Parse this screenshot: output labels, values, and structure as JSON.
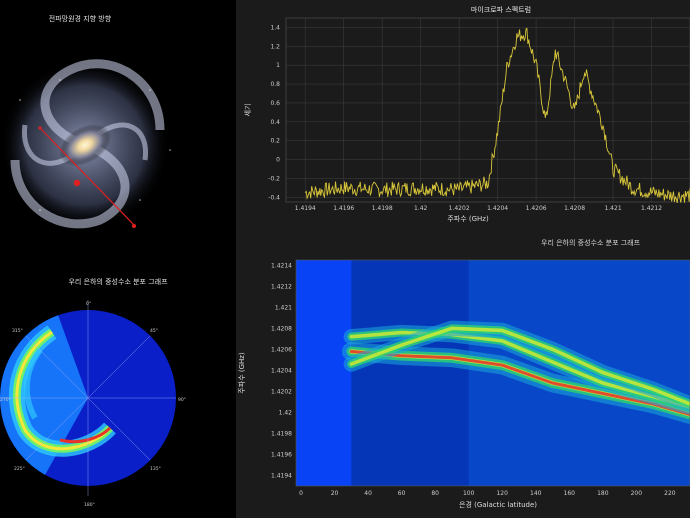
{
  "left": {
    "galaxy_title": "전파망원경 지향 방향",
    "polar_title": "우리 은하의 중성수소 분포 그래프",
    "polar_angle_labels": [
      "0°",
      "45°",
      "90°",
      "135°",
      "180°",
      "225°",
      "270°",
      "315°"
    ]
  },
  "spectrum": {
    "title": "마이크로파 스펙트럼",
    "xlabel": "주파수 (GHz)",
    "ylabel": "세기"
  },
  "map": {
    "title": "우리 은하의 중성수소 분포 그래프",
    "xlabel": "은경 (Galactic latitude)",
    "ylabel": "주파수 (GHz)"
  },
  "chart_data": [
    {
      "type": "line",
      "title": "마이크로파 스펙트럼",
      "xlabel": "주파수 (GHz)",
      "ylabel": "세기",
      "xlim": [
        1.4193,
        1.4214
      ],
      "ylim": [
        -0.45,
        1.5
      ],
      "xticks": [
        1.4194,
        1.4196,
        1.4198,
        1.42,
        1.4202,
        1.4204,
        1.4206,
        1.4208,
        1.421,
        1.4212
      ],
      "yticks": [
        -0.4,
        -0.2,
        0,
        0.2,
        0.4,
        0.6,
        0.8,
        1,
        1.2,
        1.4
      ],
      "x": [
        1.4194,
        1.4196,
        1.4198,
        1.42,
        1.4202,
        1.42035,
        1.4204,
        1.42045,
        1.4205,
        1.42055,
        1.4206,
        1.42065,
        1.4207,
        1.42075,
        1.4208,
        1.42085,
        1.4209,
        1.42095,
        1.421,
        1.4211,
        1.4212,
        1.4213
      ],
      "y": [
        -0.35,
        -0.3,
        -0.32,
        -0.3,
        -0.32,
        -0.25,
        0.3,
        1.0,
        1.3,
        1.35,
        1.0,
        0.4,
        1.15,
        0.85,
        0.5,
        0.95,
        0.65,
        0.35,
        -0.1,
        -0.3,
        -0.35,
        -0.38
      ]
    },
    {
      "type": "heatmap",
      "title": "우리 은하의 중성수소 분포 그래프",
      "xlabel": "은경 (Galactic latitude)",
      "ylabel": "주파수 (GHz)",
      "xlim": [
        -3,
        232
      ],
      "ylim": [
        1.4193,
        1.42145
      ],
      "xticks": [
        0,
        20,
        40,
        60,
        80,
        100,
        120,
        140,
        160,
        180,
        200,
        220
      ],
      "yticks": [
        1.4194,
        1.4196,
        1.4198,
        1.42,
        1.4202,
        1.4204,
        1.4206,
        1.4208,
        1.421,
        1.4212,
        1.4214
      ],
      "ridges": [
        {
          "x": [
            30,
            60,
            90,
            120,
            150,
            180,
            210,
            232
          ],
          "y": [
            1.42058,
            1.42054,
            1.42052,
            1.42045,
            1.42028,
            1.42018,
            1.42008,
            1.41998
          ]
        },
        {
          "x": [
            30,
            60,
            90,
            120,
            150,
            180,
            210,
            232
          ],
          "y": [
            1.42072,
            1.42076,
            1.42074,
            1.42068,
            1.42048,
            1.42028,
            1.42015,
            1.42005
          ]
        },
        {
          "x": [
            30,
            60,
            90,
            120,
            150,
            180,
            210,
            232
          ],
          "y": [
            1.42046,
            1.42064,
            1.4208,
            1.42078,
            1.4206,
            1.42038,
            1.42022,
            1.42008
          ]
        }
      ]
    }
  ]
}
